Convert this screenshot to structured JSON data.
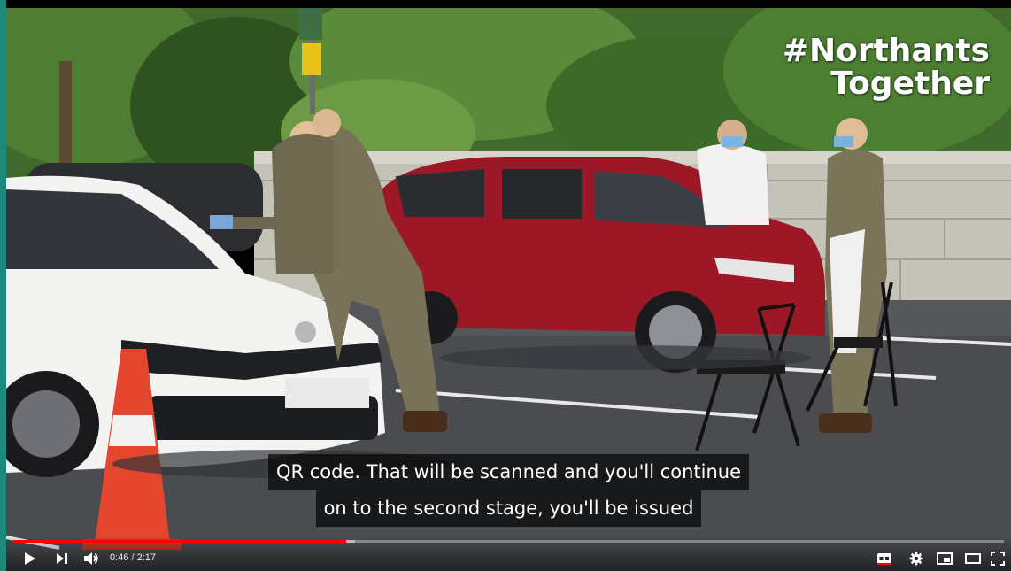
{
  "overlay": {
    "hashtag_line1": "#Northants",
    "hashtag_line2": "Together"
  },
  "captions": {
    "line1": "QR code. That will be scanned and you'll continue",
    "line2": "on to the second stage, you'll be issued"
  },
  "player": {
    "current_time": "0:46",
    "separator": "/",
    "duration": "2:17",
    "played_fraction": 0.336,
    "buffered_fraction": 0.345,
    "accent_color": "#ff0000",
    "buttons": {
      "play": "play-icon",
      "next": "next-icon",
      "volume": "volume-icon",
      "subtitles": "subtitles-icon",
      "settings": "gear-icon",
      "miniplayer": "miniplayer-icon",
      "theater": "theater-mode-icon",
      "fullscreen": "fullscreen-icon"
    }
  }
}
